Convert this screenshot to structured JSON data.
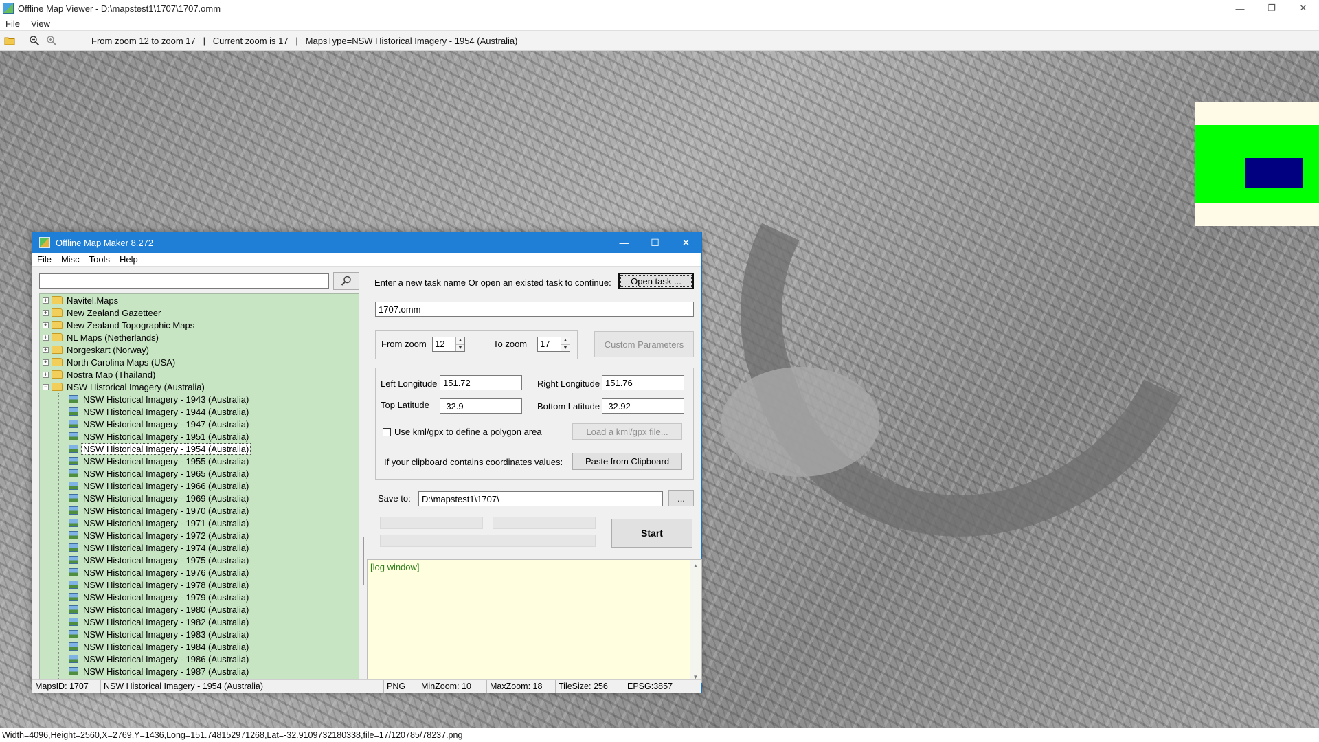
{
  "viewer": {
    "title": "Offline Map Viewer - D:\\mapstest1\\1707\\1707.omm",
    "window_controls": {
      "minimize": "—",
      "restore": "❐",
      "close": "✕"
    },
    "menu": [
      "File",
      "View"
    ],
    "toolbar_status": "From zoom 12 to zoom 17   |   Current zoom is 17   |   MapsType=NSW Historical Imagery - 1954 (Australia)",
    "status_bar": "Width=4096,Height=2560,X=2769,Y=1436,Long=151.748152971268,Lat=-32.9109732180338,file=17/120785/78237.png"
  },
  "dialog": {
    "title": "Offline Map Maker 8.272",
    "menu": [
      "File",
      "Misc",
      "Tools",
      "Help"
    ],
    "search_value": "",
    "tree": {
      "folders": [
        "Navitel.Maps",
        "New Zealand Gazetteer",
        "New Zealand Topographic Maps",
        "NL Maps (Netherlands)",
        "Norgeskart (Norway)",
        "North Carolina Maps (USA)",
        "Nostra Map (Thailand)"
      ],
      "open_folder": "NSW Historical Imagery (Australia)",
      "children": [
        "NSW Historical Imagery - 1943 (Australia)",
        "NSW Historical Imagery - 1944 (Australia)",
        "NSW Historical Imagery - 1947 (Australia)",
        "NSW Historical Imagery - 1951 (Australia)",
        "NSW Historical Imagery - 1954 (Australia)",
        "NSW Historical Imagery - 1955 (Australia)",
        "NSW Historical Imagery - 1965 (Australia)",
        "NSW Historical Imagery - 1966 (Australia)",
        "NSW Historical Imagery - 1969 (Australia)",
        "NSW Historical Imagery - 1970 (Australia)",
        "NSW Historical Imagery - 1971 (Australia)",
        "NSW Historical Imagery - 1972 (Australia)",
        "NSW Historical Imagery - 1974 (Australia)",
        "NSW Historical Imagery - 1975 (Australia)",
        "NSW Historical Imagery - 1976 (Australia)",
        "NSW Historical Imagery - 1978 (Australia)",
        "NSW Historical Imagery - 1979 (Australia)",
        "NSW Historical Imagery - 1980 (Australia)",
        "NSW Historical Imagery - 1982 (Australia)",
        "NSW Historical Imagery - 1983 (Australia)",
        "NSW Historical Imagery - 1984 (Australia)",
        "NSW Historical Imagery - 1986 (Australia)",
        "NSW Historical Imagery - 1987 (Australia)"
      ],
      "selected_child": "NSW Historical Imagery - 1954 (Australia)"
    },
    "task_prompt": "Enter a new task name Or open an existed task to continue:",
    "open_task_label": "Open task ...",
    "task_name": "1707.omm",
    "from_zoom_label": "From zoom",
    "from_zoom": "12",
    "to_zoom_label": "To zoom",
    "to_zoom": "17",
    "custom_params_label": "Custom Parameters",
    "left_longitude_label": "Left Longitude",
    "left_longitude": "151.72",
    "right_longitude_label": "Right Longitude",
    "right_longitude": "151.76",
    "top_latitude_label": "Top Latitude",
    "top_latitude": "-32.9",
    "bottom_latitude_label": "Bottom Latitude",
    "bottom_latitude": "-32.92",
    "use_kml_label": "Use kml/gpx to define a polygon area",
    "load_kml_label": "Load a kml/gpx file...",
    "clipboard_prompt": "If your clipboard contains coordinates values:",
    "paste_label": "Paste from Clipboard",
    "save_to_label": "Save to:",
    "save_to_path": "D:\\mapstest1\\1707\\",
    "browse_label": "...",
    "start_label": "Start",
    "log_text": "[log window]",
    "status": {
      "maps_id": "MapsID: 1707",
      "maps_name": "NSW Historical Imagery - 1954 (Australia)",
      "format": "PNG",
      "min_zoom": "MinZoom: 10",
      "max_zoom": "MaxZoom: 18",
      "tile_size": "TileSize: 256",
      "epsg": "EPSG:3857"
    }
  },
  "colors": {
    "tree_bg": "#c7e4c3",
    "log_bg": "#ffffe0",
    "dialog_title": "#1f7fd6",
    "minimap_green": "#00ff00",
    "minimap_blue": "#000080"
  }
}
